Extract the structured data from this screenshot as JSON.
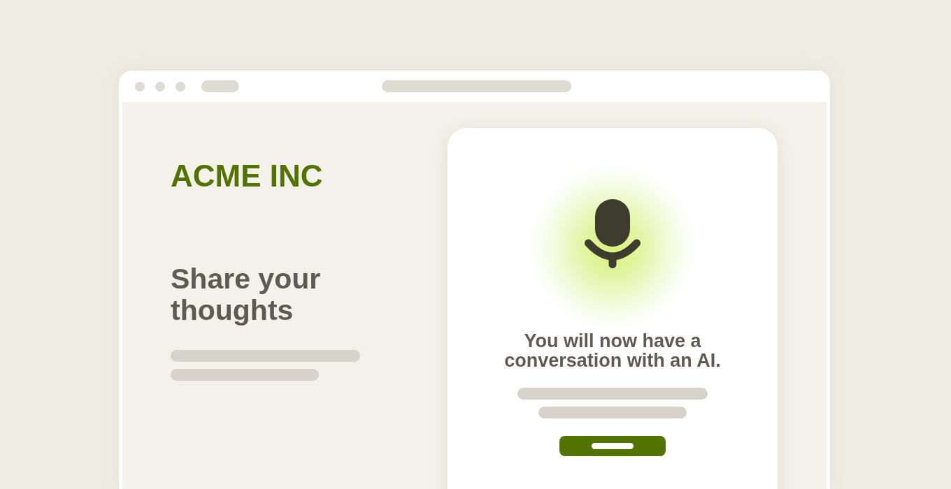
{
  "page": {
    "brand": "ACME INC",
    "heading": "Share your thoughts"
  },
  "voice_card": {
    "message": "You will now have a conversation with an AI."
  }
}
